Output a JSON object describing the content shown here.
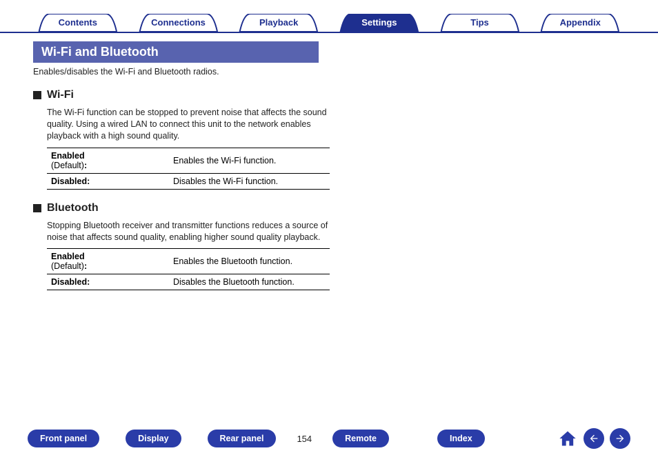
{
  "topTabs": {
    "contents": "Contents",
    "connections": "Connections",
    "playback": "Playback",
    "settings": "Settings",
    "tips": "Tips",
    "appendix": "Appendix"
  },
  "page": {
    "title": "Wi-Fi and Bluetooth",
    "subtitle": "Enables/disables the Wi-Fi and Bluetooth radios.",
    "number": "154"
  },
  "wifi": {
    "heading": "Wi-Fi",
    "desc": "The Wi-Fi function can be stopped to prevent noise that affects the sound quality. Using a wired LAN to connect this unit to the network enables playback with a high sound quality.",
    "enabled_label": "Enabled",
    "default_label": "(Default)",
    "colon": ":",
    "enabled_desc": "Enables the Wi-Fi function.",
    "disabled_label": "Disabled:",
    "disabled_desc": "Disables the Wi-Fi function."
  },
  "bluetooth": {
    "heading": "Bluetooth",
    "desc": "Stopping Bluetooth receiver and transmitter functions reduces a source of noise that affects sound quality, enabling higher sound quality playback.",
    "enabled_label": "Enabled",
    "default_label": "(Default)",
    "colon": ":",
    "enabled_desc": "Enables the Bluetooth function.",
    "disabled_label": "Disabled:",
    "disabled_desc": "Disables the Bluetooth function."
  },
  "bottomNav": {
    "front_panel": "Front panel",
    "display": "Display",
    "rear_panel": "Rear panel",
    "remote": "Remote",
    "index": "Index"
  }
}
